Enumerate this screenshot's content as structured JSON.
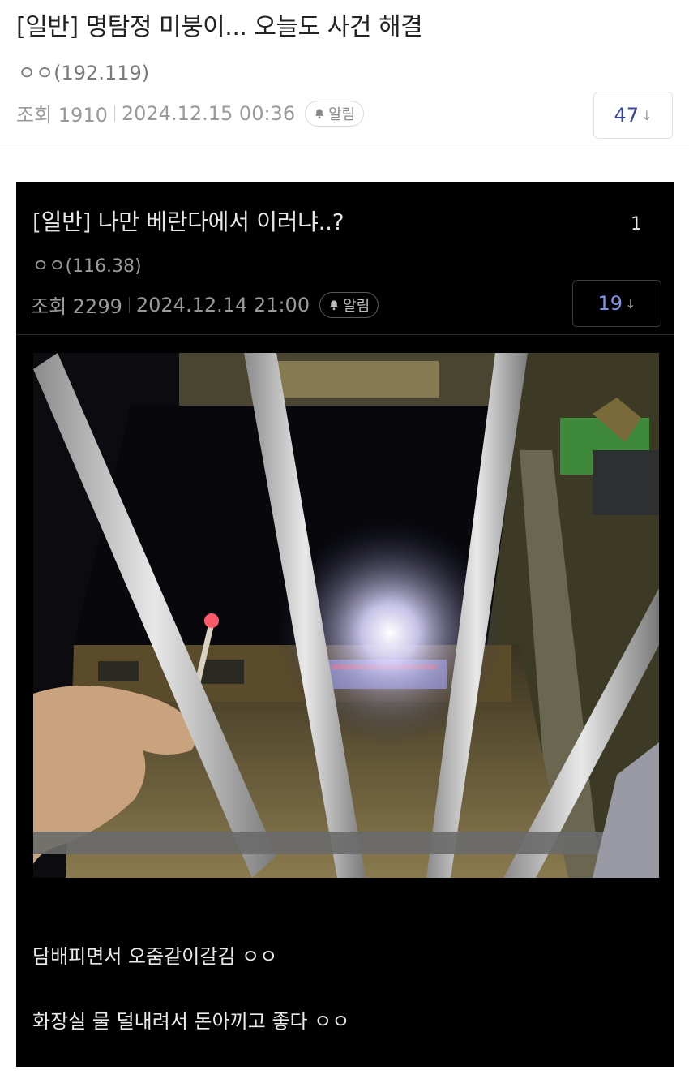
{
  "post": {
    "title": "[일반] 명탐정 미붕이... 오늘도 사건 해결",
    "author": "ㅇㅇ(192.119)",
    "views": "조회 1910",
    "datetime": "2024.12.15 00:36",
    "alarm_label": "알림",
    "comment_count": "47",
    "comment_arrow": "↓"
  },
  "embedded_post": {
    "title": "[일반] 나만 베란다에서 이러냐..?",
    "number": "1",
    "author": "ㅇㅇ(116.38)",
    "views": "조회 2299",
    "datetime": "2024.12.14 21:00",
    "alarm_label": "알림",
    "comment_count": "19",
    "comment_arrow": "↓",
    "body_lines": [
      "담배피면서 오줌같이갈김 ㅇㅇ",
      "화장실 물 덜내려서 돈아끼고 좋다 ㅇㅇ"
    ]
  },
  "colors": {
    "accent": "#35469c",
    "embed_bg": "#000000"
  }
}
